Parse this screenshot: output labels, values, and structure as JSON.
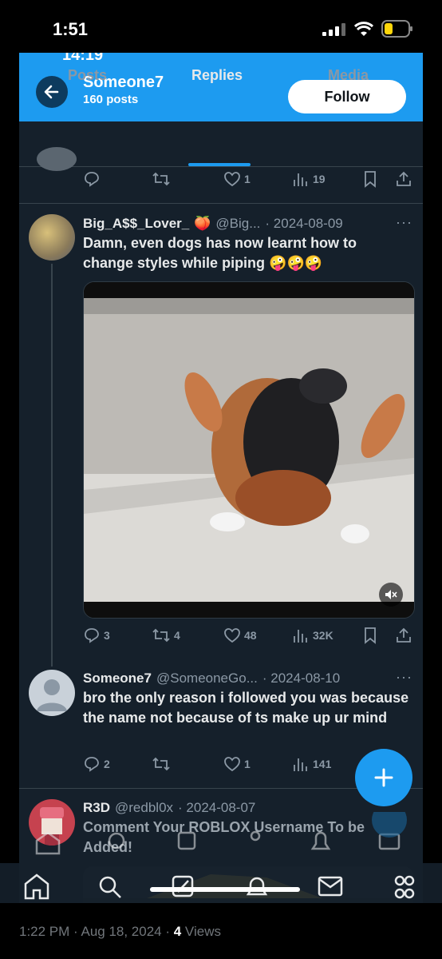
{
  "device": {
    "time": "1:51"
  },
  "inner": {
    "time": "14:19"
  },
  "profile": {
    "name": "Someone7",
    "posts": "160 posts",
    "follow_label": "Follow"
  },
  "tabs": [
    {
      "label": "Posts"
    },
    {
      "label": "Replies"
    },
    {
      "label": "Media"
    }
  ],
  "top_actions": {
    "likes": "1",
    "views": "19"
  },
  "post1": {
    "name": "Big_A$$_Lover_",
    "handle": "@Big...",
    "date": "· 2024-08-09",
    "text": "Damn, even dogs  has now learnt how to change styles while piping 🤪🤪🤪",
    "replies": "3",
    "reposts": "4",
    "likes": "48",
    "views": "32K"
  },
  "post2": {
    "name": "Someone7",
    "handle": "@SomeoneGo...",
    "date": "· 2024-08-10",
    "text": "bro the only reason i followed you was because the name not because of ts make up ur mind",
    "replies": "2",
    "likes": "1",
    "views": "141"
  },
  "post3": {
    "name": "R3D",
    "handle": "@redbl0x",
    "date": "· 2024-08-07",
    "text": "Comment Your ROBLOX Username To be Added!"
  },
  "footer": {
    "time": "1:22 PM · Aug 18, 2024 · ",
    "views_count": "4",
    "views_label": " Views"
  },
  "colors": {
    "accent": "#1d9bf0",
    "background": "#15202b",
    "divider": "#38444d"
  },
  "icons": [
    "back-arrow-icon",
    "reply-icon",
    "repost-icon",
    "like-icon",
    "views-icon",
    "bookmark-icon",
    "share-icon",
    "more-icon",
    "mute-icon",
    "plus-icon",
    "home-icon",
    "search-icon",
    "grok-icon",
    "communities-icon",
    "notifications-icon",
    "messages-icon"
  ]
}
